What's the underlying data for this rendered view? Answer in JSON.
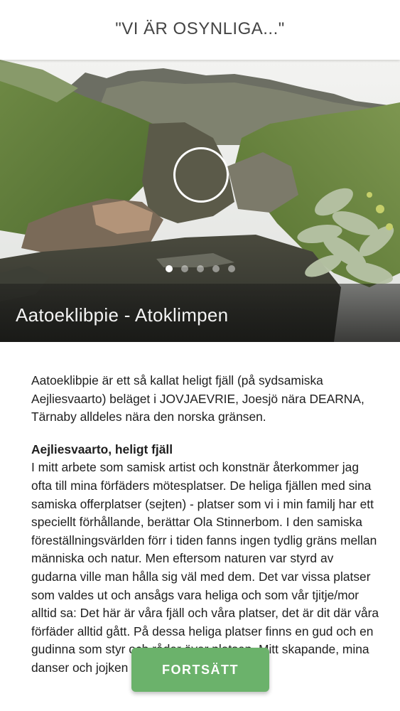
{
  "header": {
    "title": "\"VI ÄR OSYNLIGA...\""
  },
  "hero": {
    "caption": "Aatoeklibpie - Atoklimpen",
    "slide_count": 5,
    "active_slide": 1,
    "media_icon": "circle-ring-icon"
  },
  "article": {
    "intro": "Aatoeklibpie är ett så kallat heligt fjäll (på sydsamiska Aejliesvaarto) beläget i JOVJAEVRIE, Joesjö nära DEARNA, Tärnaby alldeles nära den norska gränsen.",
    "section_heading": "Aejliesvaarto, heligt fjäll",
    "section_body": "I mitt arbete som samisk artist och konstnär återkommer jag ofta till mina förfäders mötesplatser. De heliga fjällen med sina samiska offerplatser (sejten) - platser som vi i min familj har ett speciellt förhållande, berättar Ola Stinnerbom. I den samiska föreställningsvärlden förr i tiden fanns ingen tydlig gräns mellan människa och natur. Men eftersom naturen var styrd av gudarna ville man hålla sig väl med dem. Det var vissa platser som valdes ut och ansågs vara heliga och som vår tjitje/mor alltid sa: Det här är våra fjäll och våra platser, det är dit där våra förfäder alltid gått. På dessa heliga platser finns en gud och en gudinna som styr och råder över platsen. Mitt skapande, mina danser och jojken ger mig kraft och med"
  },
  "actions": {
    "continue_label": "FORTSÄTT"
  },
  "colors": {
    "accent_button": "#6bb26b",
    "header_bg": "#ffffff"
  }
}
